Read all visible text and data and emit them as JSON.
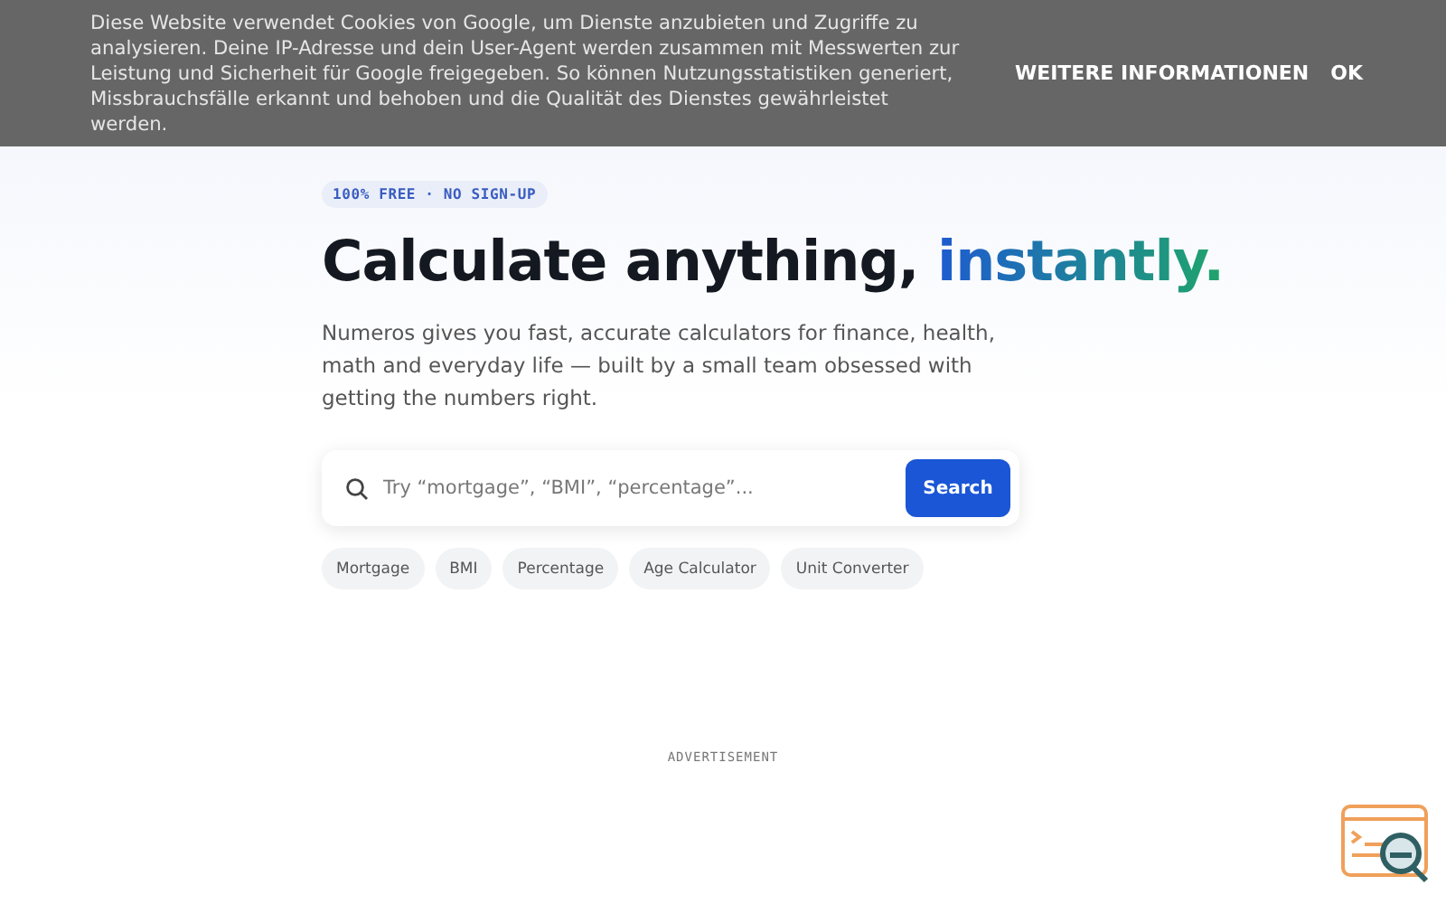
{
  "cookie_bar": {
    "text": "Diese Website verwendet Cookies von Google, um Dienste anzubieten und Zugriffe zu analysieren. Deine IP-Adresse und dein User-Agent werden zusammen mit Messwerten zur Leistung und Sicherheit für Google freigegeben. So können Nutzungsstatistiken generiert, Missbrauchsfälle erkannt und behoben und die Qualität des Dienstes gewährleistet werden.",
    "buttons": [
      "WEITERE INFORMATIONEN",
      "OK"
    ]
  },
  "hero": {
    "badge": "100% FREE · NO SIGN-UP",
    "title": "Calculate anything,",
    "title_accent": "instantly.",
    "description": "Numeros gives you fast, accurate calculators for finance, health, math and everyday life — built by a small team obsessed with getting the numbers right."
  },
  "search": {
    "placeholder": "Try “mortgage”, “BMI”, “percentage”...",
    "button": "Search"
  },
  "chips": [
    "Mortgage",
    "BMI",
    "Percentage",
    "Age Calculator",
    "Unit Converter"
  ],
  "ad_label": "ADVERTISEMENT"
}
